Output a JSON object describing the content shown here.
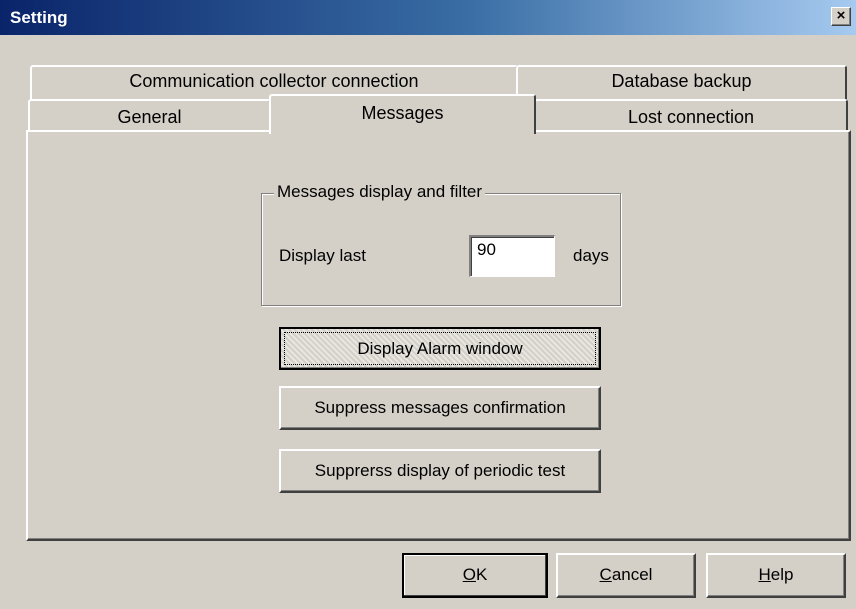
{
  "window": {
    "title": "Setting",
    "close_label": "×"
  },
  "tabs": [
    {
      "label": "Communication collector connection",
      "row": "back",
      "active": false
    },
    {
      "label": "Database backup",
      "row": "back",
      "active": false
    },
    {
      "label": "General",
      "row": "front",
      "active": false
    },
    {
      "label": "Messages",
      "row": "front",
      "active": true
    },
    {
      "label": "Lost connection",
      "row": "front",
      "active": false
    }
  ],
  "messages": {
    "group_title": "Messages display and filter",
    "display_last_label": "Display last",
    "days_value": "90",
    "days_label": "days",
    "buttons": {
      "display_alarm": "Display Alarm window",
      "suppress_confirmation": "Suppress messages confirmation",
      "suppress_periodic": "Supprerss display of periodic test"
    }
  },
  "footer": {
    "ok": {
      "mnemonic": "O",
      "rest": "K"
    },
    "cancel": {
      "mnemonic": "C",
      "rest": "ancel"
    },
    "help": {
      "mnemonic": "H",
      "rest": "elp"
    }
  },
  "colors": {
    "face": "#d4d0c8",
    "title_start": "#0a246a",
    "title_end": "#a6caf0"
  }
}
